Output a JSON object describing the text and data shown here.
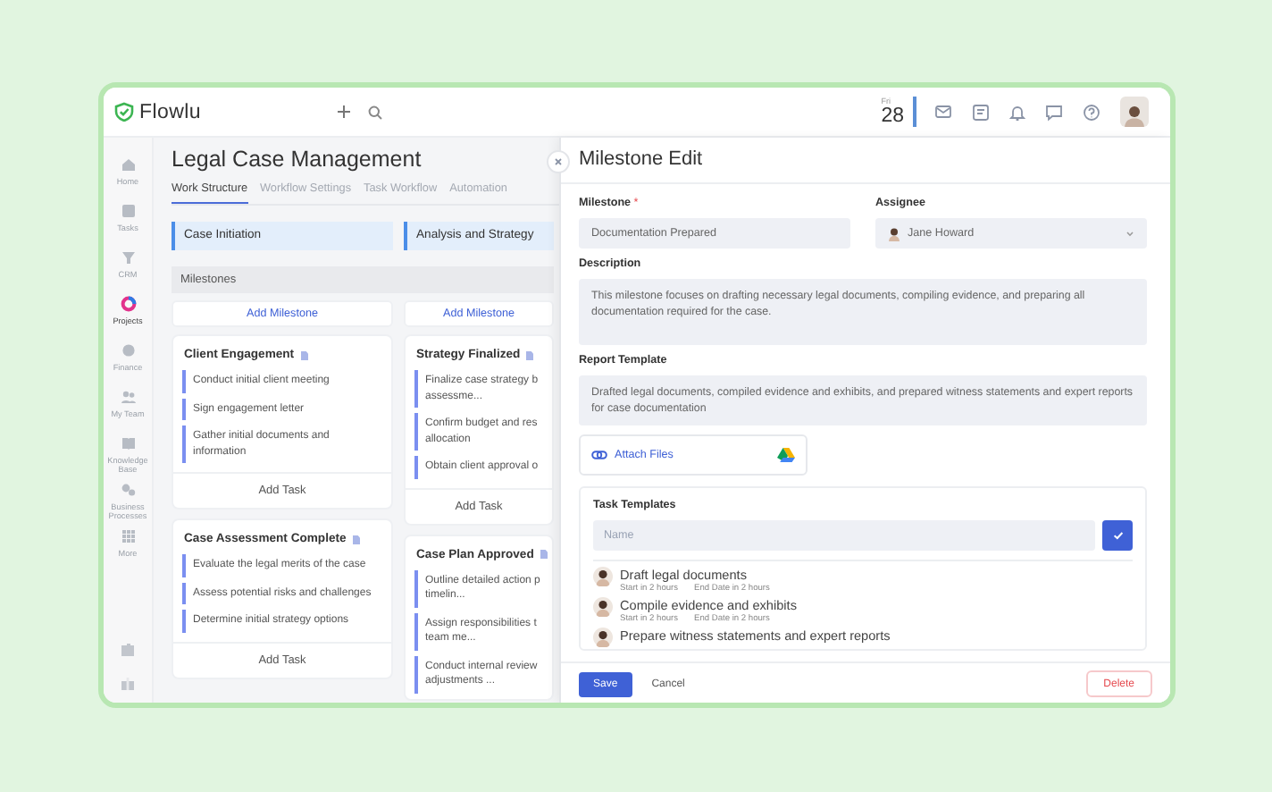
{
  "app": {
    "logo": "Flowlu"
  },
  "top_bar": {
    "weekday": "Fri",
    "day": "28"
  },
  "sidebar": {
    "items": [
      {
        "label": "Home",
        "selected": false
      },
      {
        "label": "Tasks",
        "selected": false
      },
      {
        "label": "CRM",
        "selected": false
      },
      {
        "label": "Projects",
        "selected": true
      },
      {
        "label": "Finance",
        "selected": false
      },
      {
        "label": "My Team",
        "selected": false
      },
      {
        "label": "Knowledge Base",
        "selected": false
      },
      {
        "label": "Business Processes",
        "selected": false
      },
      {
        "label": "More",
        "selected": false
      }
    ]
  },
  "project": {
    "title": "Legal Case Management",
    "tabs": [
      {
        "label": "Work Structure",
        "selected": true
      },
      {
        "label": "Workflow Settings",
        "selected": false
      },
      {
        "label": "Task Workflow",
        "selected": false
      },
      {
        "label": "Automation",
        "selected": false
      }
    ],
    "milestones_label": "Milestones",
    "stages": [
      {
        "name": "Case Initiation",
        "add_milestone": "Add Milestone",
        "milestones": [
          {
            "title": "Client Engagement",
            "tasks": [
              "Conduct initial client meeting",
              "Sign engagement letter",
              "Gather initial documents and information"
            ],
            "add_task": "Add Task"
          },
          {
            "title": "Case Assessment Complete",
            "tasks": [
              "Evaluate the legal merits of the case",
              "Assess potential risks and challenges",
              "Determine initial strategy options"
            ],
            "add_task": "Add Task"
          }
        ]
      },
      {
        "name": "Analysis and Strategy",
        "add_milestone": "Add Milestone",
        "milestones": [
          {
            "title": "Strategy Finalized",
            "tasks": [
              "Finalize case strategy b\nassessme...",
              "Confirm budget and res\nallocation",
              "Obtain client approval o"
            ],
            "add_task": "Add Task"
          },
          {
            "title": "Case Plan Approved",
            "tasks": [
              "Outline detailed action p\ntimelin...",
              "Assign responsibilities t\nteam me...",
              "Conduct internal review\nadjustments ..."
            ]
          }
        ]
      }
    ]
  },
  "panel": {
    "title": "Milestone Edit",
    "milestone": {
      "label": "Milestone",
      "required_mark": "*",
      "value": "Documentation Prepared"
    },
    "assignee": {
      "label": "Assignee",
      "value": "Jane Howard"
    },
    "description": {
      "label": "Description",
      "value": "This milestone focuses on drafting necessary legal documents, compiling evidence, and preparing all documentation required for the case."
    },
    "report_template": {
      "label": "Report Template",
      "value": "Drafted legal documents, compiled evidence and exhibits, and prepared witness statements and expert reports for case documentation"
    },
    "attach": {
      "label": "Attach Files"
    },
    "task_templates": {
      "label": "Task Templates",
      "placeholder": "Name",
      "items": [
        {
          "title": "Draft legal documents",
          "start": "Start in 2 hours",
          "end": "End Date in 2 hours"
        },
        {
          "title": "Compile evidence and exhibits",
          "start": "Start in 2 hours",
          "end": "End Date in 2 hours"
        },
        {
          "title": "Prepare witness statements and expert reports"
        }
      ]
    },
    "footer": {
      "save": "Save",
      "cancel": "Cancel",
      "delete": "Delete"
    }
  }
}
